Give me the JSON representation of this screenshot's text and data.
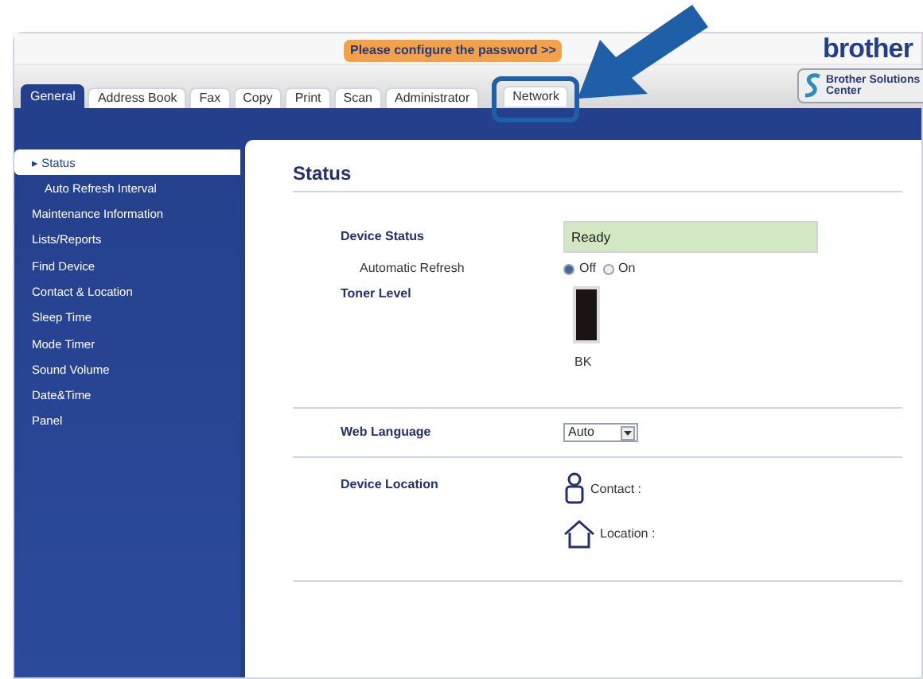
{
  "banner": {
    "label": "Please configure the password >>"
  },
  "logo": "brother",
  "solutions_button": {
    "label": "Brother Solutions Center"
  },
  "tabs": [
    {
      "label": "General",
      "selected": true
    },
    {
      "label": "Address Book",
      "selected": false
    },
    {
      "label": "Fax",
      "selected": false
    },
    {
      "label": "Copy",
      "selected": false
    },
    {
      "label": "Print",
      "selected": false
    },
    {
      "label": "Scan",
      "selected": false
    },
    {
      "label": "Administrator",
      "selected": false
    },
    {
      "label": "Network",
      "selected": false,
      "highlighted": true
    }
  ],
  "sidebar": {
    "items": [
      {
        "label": "▸ Status",
        "selected": true,
        "children": [
          {
            "label": "Auto Refresh Interval",
            "selected": false
          }
        ]
      },
      {
        "label": "Maintenance Information",
        "selected": false
      },
      {
        "label": "Lists/Reports",
        "selected": false
      },
      {
        "label": "Find Device",
        "selected": false
      },
      {
        "label": "Contact & Location",
        "selected": false
      },
      {
        "label": "Sleep Time",
        "selected": false
      },
      {
        "label": "Mode Timer",
        "selected": false
      },
      {
        "label": "Sound Volume",
        "selected": false
      },
      {
        "label": "Date&Time",
        "selected": false
      },
      {
        "label": "Panel",
        "selected": false
      }
    ]
  },
  "content": {
    "title": "Status",
    "device_status": {
      "label": "Device Status",
      "value": "Ready"
    },
    "automatic_refresh": {
      "label": "Automatic Refresh",
      "options": [
        {
          "label": "Off",
          "selected": true
        },
        {
          "label": "On",
          "selected": false
        }
      ]
    },
    "toner": {
      "label": "Toner Level",
      "items": [
        {
          "label": "BK",
          "level": 1
        }
      ]
    },
    "web_language": {
      "label": "Web Language",
      "value": "Auto"
    },
    "device_location": {
      "label": "Device Location",
      "entries": [
        {
          "kind": "contact",
          "label": "Contact :"
        },
        {
          "kind": "location",
          "label": "Location :"
        }
      ]
    }
  }
}
